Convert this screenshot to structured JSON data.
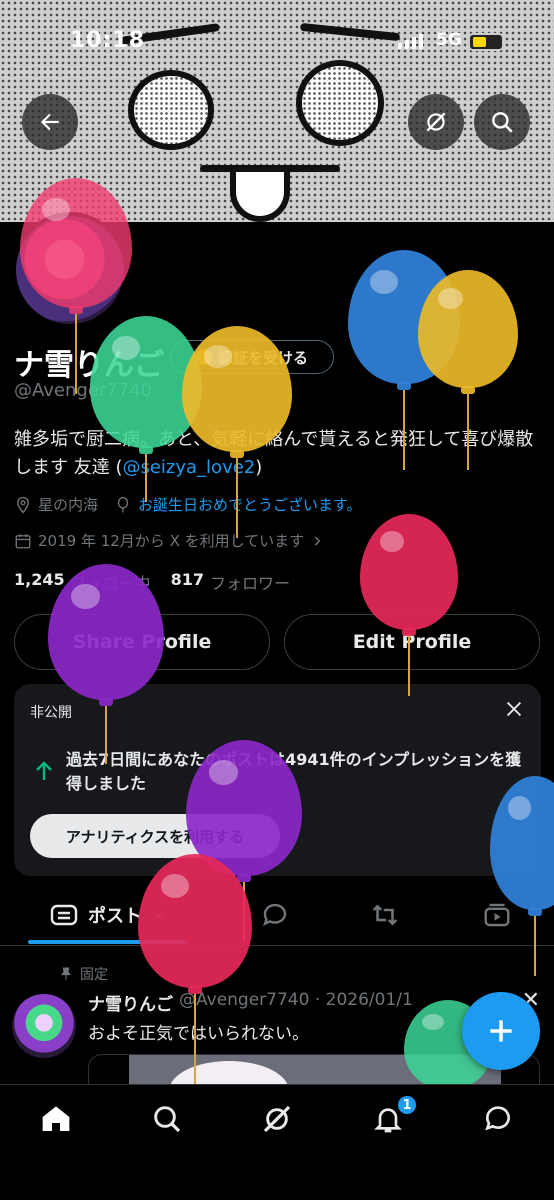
{
  "status_bar": {
    "time": "10:18",
    "network": "5G"
  },
  "profile": {
    "name": "ナ雪りんご",
    "verify_label": "認証を受ける",
    "handle": "@Avenger7740",
    "bio_text": "雑多垢で厨二病。あと、気軽に絡んで貰えると発狂して喜び爆散します 友達 (",
    "bio_link": "@seizya_love2",
    "bio_end": ")",
    "location": "星の内海",
    "birthday_text": "お誕生日おめでとうございます。",
    "joined": "2019 年 12月から X を利用しています",
    "following_count": "1,245",
    "following_label": "フォロー中",
    "followers_count": "817",
    "followers_label": "フォロワー"
  },
  "buttons": {
    "share": "Share Profile",
    "edit": "Edit Profile"
  },
  "analytics_card": {
    "private_label": "非公開",
    "message": "過去7日間にあなたのポストは4941件のインプレッションを獲得しました",
    "button": "アナリティクスを利用する"
  },
  "tabs": {
    "posts_label": "ポスト"
  },
  "pinned_post": {
    "pinned_label": "固定",
    "author": "ナ雪りんご",
    "handle_date": "@Avenger7740 · 2026/01/1",
    "text": "およそ正気ではいられない。"
  },
  "notifications_badge": "1",
  "icons": [
    "back-arrow-icon",
    "grok-icon",
    "search-icon",
    "location-pin-icon",
    "balloon-icon",
    "calendar-icon",
    "chevron-right-icon",
    "close-icon",
    "trend-up-icon",
    "posts-tab-icon",
    "chevron-down-icon",
    "reply-icon",
    "retweet-icon",
    "media-icon",
    "pin-icon",
    "plus-icon",
    "home-icon",
    "bell-icon",
    "messages-icon"
  ],
  "colors": {
    "accent": "#1d9bf0",
    "background": "#000000",
    "muted": "#71767b"
  }
}
